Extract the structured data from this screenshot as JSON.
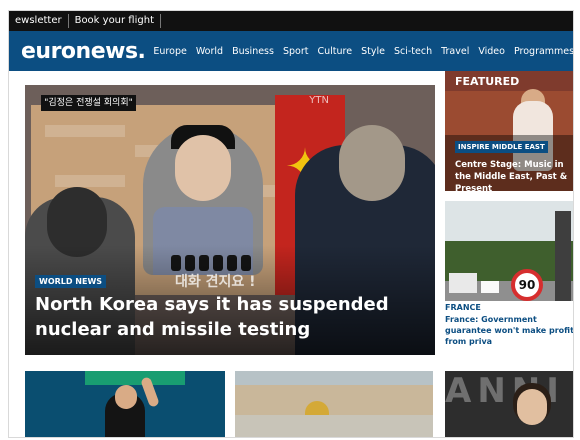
{
  "topbar": {
    "items": [
      "ewsletter",
      "Book your flight"
    ]
  },
  "nav": {
    "logo": "euronews.",
    "items": [
      "Europe",
      "World",
      "Business",
      "Sport",
      "Culture",
      "Style",
      "Sci-tech",
      "Travel",
      "Video",
      "Programmes"
    ]
  },
  "hero": {
    "tv_banner_text": "\"김정은 전쟁설 회의회\"",
    "tv_logo": "YTN",
    "korean_caption": "대화 견지요 !",
    "tag": "WORLD NEWS",
    "headline": "North Korea says it has suspended nuclear and missile testing"
  },
  "featured": {
    "label": "FEATURED",
    "tag": "INSPIRE MIDDLE EAST",
    "title": "Centre Stage: Music in the Middle East, Past & Present"
  },
  "france_card": {
    "sign_value": "90",
    "tag": "FRANCE",
    "title": "France: Government guarantee won't make profit from priva"
  },
  "bottom": {
    "tile_c_text": "ANNI"
  },
  "colors": {
    "brand_blue": "#0c4e82",
    "topbar": "#111111"
  }
}
